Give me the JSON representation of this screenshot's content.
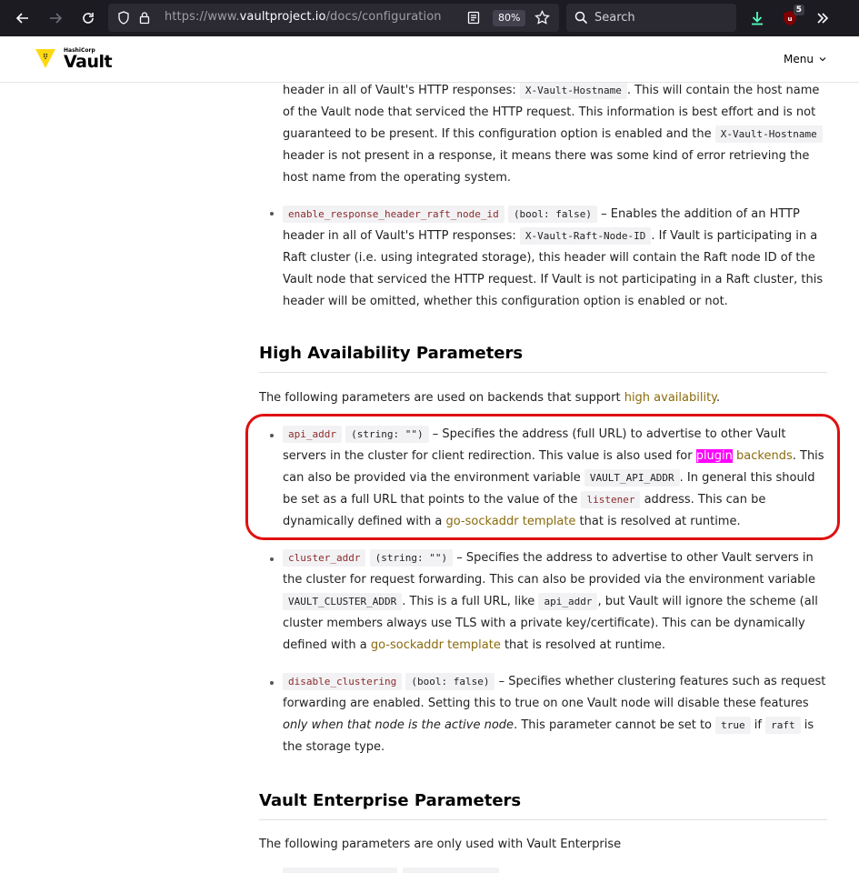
{
  "browser": {
    "url_prefix": "https://www.",
    "url_domain": "vaultproject.io",
    "url_path": "/docs/configuration",
    "zoom": "80%",
    "search_placeholder": "Search",
    "ublock_count": "5"
  },
  "site": {
    "logo_company": "HashiCorp",
    "logo_product": "Vault",
    "menu_label": "Menu"
  },
  "content": {
    "p1": {
      "t1": "header in all of Vault's HTTP responses: ",
      "c1": "X-Vault-Hostname",
      "t2": ". This will contain the host name of the Vault node that serviced the HTTP request. This information is best effort and is not guaranteed to be present. If this configuration option is enabled and the ",
      "c2": "X-Vault-Hostname",
      "t3": " header is not present in a response, it means there was some kind of error retrieving the host name from the operating system."
    },
    "p2": {
      "c1": "enable_response_header_raft_node_id",
      "c2": "(bool: false)",
      "t1": " – Enables the addition of an HTTP header in all of Vault's HTTP responses: ",
      "c3": "X-Vault-Raft-Node-ID",
      "t2": ". If Vault is participating in a Raft cluster (i.e. using integrated storage), this header will contain the Raft node ID of the Vault node that serviced the HTTP request. If Vault is not participating in a Raft cluster, this header will be omitted, whether this configuration option is enabled or not."
    },
    "h_ha": "High Availability Parameters",
    "ha_intro": {
      "t1": "The following parameters are used on backends that support ",
      "link": "high availability",
      "t2": "."
    },
    "p3": {
      "c1": "api_addr",
      "c2": "(string: \"\")",
      "t1": " – Specifies the address (full URL) to advertise to other Vault servers in the cluster for client redirection. This value is also used for ",
      "hl": "plugin",
      "link1": " backends",
      "t2": ". This can also be provided via the environment variable ",
      "c3": "VAULT_API_ADDR",
      "t3": ". In general this should be set as a full URL that points to the value of the ",
      "c4": "listener",
      "t4": " address. This can be dynamically defined with a ",
      "link2": "go-sockaddr template",
      "t5": " that is resolved at runtime."
    },
    "p4": {
      "c1": "cluster_addr",
      "c2": "(string: \"\")",
      "t1": " – Specifies the address to advertise to other Vault servers in the cluster for request forwarding. This can also be provided via the environment variable ",
      "c3": "VAULT_CLUSTER_ADDR",
      "t2": ". This is a full URL, like ",
      "c4": "api_addr",
      "t3": ", but Vault will ignore the scheme (all cluster members always use TLS with a private key/certificate). This can be dynamically defined with a ",
      "link": "go-sockaddr template",
      "t4": " that is resolved at runtime."
    },
    "p5": {
      "c1": "disable_clustering",
      "c2": "(bool: false)",
      "t1": " – Specifies whether clustering features such as request forwarding are enabled. Setting this to true on one Vault node will disable these features ",
      "em": "only when that node is the active node",
      "t2": ". This parameter cannot be set to ",
      "c3": "true",
      "t3": " if ",
      "c4": "raft",
      "t4": " is the storage type."
    },
    "h_ent": "Vault Enterprise Parameters",
    "ent_intro": "The following parameters are only used with Vault Enterprise"
  },
  "colors": {
    "link": "#8a6b0c",
    "highlight": "#ff00ff",
    "annotation_box": "#e01010",
    "chrome_bg": "#1c1b22"
  }
}
